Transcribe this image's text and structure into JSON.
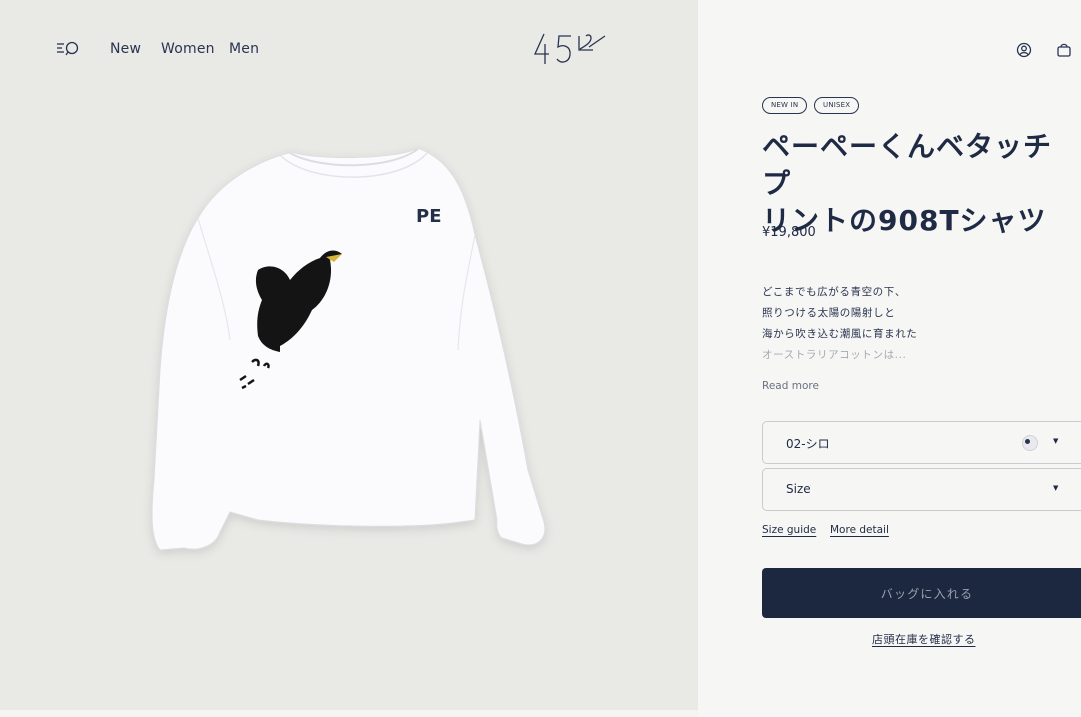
{
  "nav": {
    "links": [
      "New",
      "Women",
      "Men"
    ],
    "logo_text": "45R",
    "menu_icon": "menu-search-icon",
    "account_icon": "user-icon",
    "cart_icon": "shopping-bag-icon"
  },
  "product": {
    "image_print_text": "PE",
    "badges": [
      "NEW IN",
      "UNISEX"
    ],
    "title_line1": "ペーペーくんベタッチプ",
    "title_line2": "リントの908Tシャツ",
    "price": "¥19,800",
    "description": [
      "どこまでも広がる青空の下、",
      "照りつける太陽の陽射しと",
      "海から吹き込む潮風に育まれた",
      "オーストラリアコットンは..."
    ],
    "read_more": "Read more",
    "color_select": {
      "value": "02-シロ"
    },
    "size_select": {
      "value": "Size"
    },
    "size_guide": "Size guide",
    "more_detail": "More detail",
    "add_to_bag": "バッグに入れる",
    "store_stock": "店頭在庫を確認する"
  },
  "colors": {
    "navy": "#1c2740",
    "left_bg": "#e9e9e6",
    "right_bg": "#f6f6f4"
  }
}
